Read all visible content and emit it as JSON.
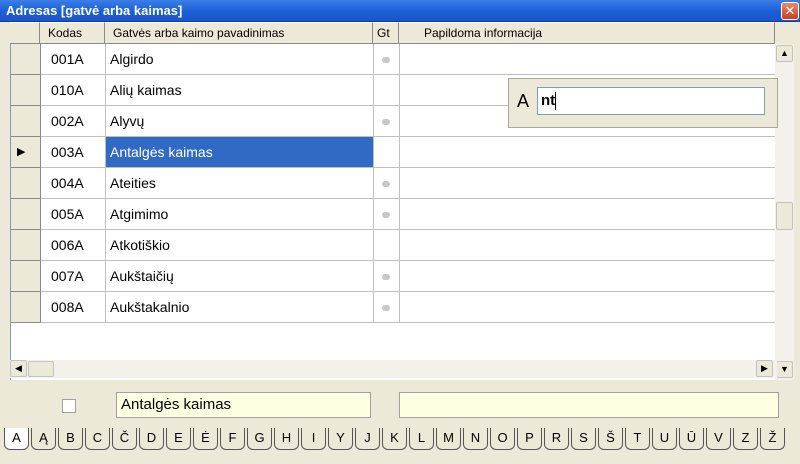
{
  "window": {
    "title": "Adresas [gatvė arba kaimas]",
    "close_glyph": "✕"
  },
  "columns": {
    "code": "Kodas",
    "name": "Gatvės arba kaimo pavadinimas",
    "gt": "Gt",
    "info": "Papildoma informacija"
  },
  "rows": [
    {
      "code": "001A",
      "name": "Algirdo",
      "gt": true,
      "selected": false
    },
    {
      "code": "010A",
      "name": "Alių kaimas",
      "gt": false,
      "selected": false
    },
    {
      "code": "002A",
      "name": "Alyvų",
      "gt": true,
      "selected": false
    },
    {
      "code": "003A",
      "name": "Antalgės kaimas",
      "gt": false,
      "selected": true
    },
    {
      "code": "004A",
      "name": "Ateities",
      "gt": true,
      "selected": false
    },
    {
      "code": "005A",
      "name": "Atgimimo",
      "gt": true,
      "selected": false
    },
    {
      "code": "006A",
      "name": "Atkotiškio",
      "gt": false,
      "selected": false
    },
    {
      "code": "007A",
      "name": "Aukštaičių",
      "gt": true,
      "selected": false
    },
    {
      "code": "008A",
      "name": "Aukštakalnio",
      "gt": true,
      "selected": false
    }
  ],
  "search": {
    "letter": "A",
    "value": "nt"
  },
  "footer": {
    "name_value": "Antalgės kaimas",
    "info_value": ""
  },
  "alphabet_tabs": [
    "A",
    "Ą",
    "B",
    "C",
    "Č",
    "D",
    "E",
    "Ė",
    "F",
    "G",
    "H",
    "I",
    "Y",
    "J",
    "K",
    "L",
    "M",
    "N",
    "O",
    "P",
    "R",
    "S",
    "Š",
    "T",
    "U",
    "Ū",
    "V",
    "Z",
    "Ž"
  ],
  "active_tab": "A",
  "icons": {
    "scroll_up": "▲",
    "scroll_down": "▼",
    "scroll_left": "◀",
    "scroll_right": "▶",
    "row_pointer": "▶"
  }
}
